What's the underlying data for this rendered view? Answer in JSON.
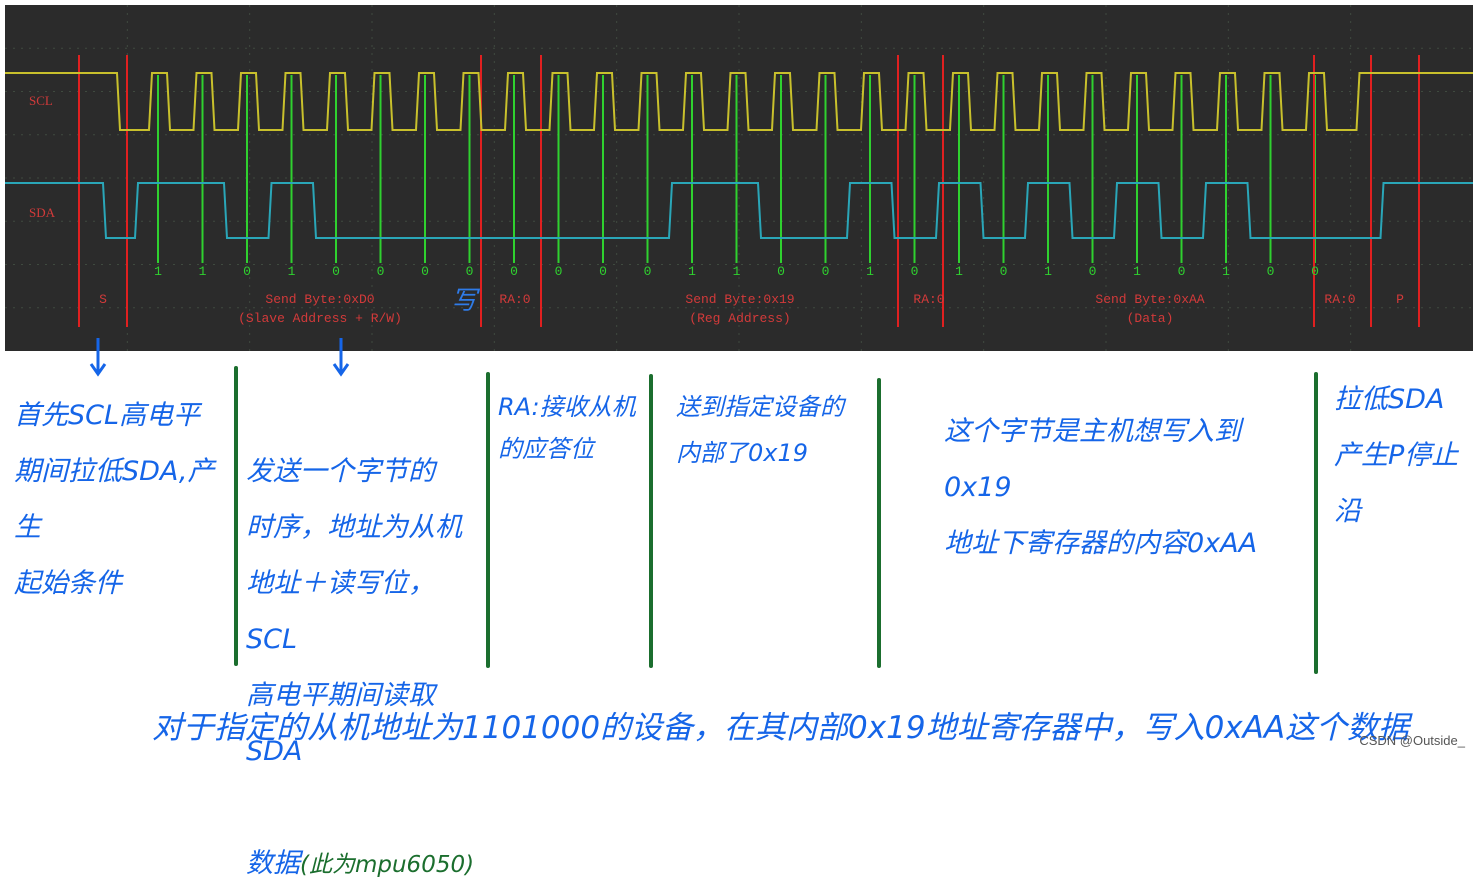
{
  "scope": {
    "channel_scl": "SCL",
    "channel_sda": "SDA",
    "bits": [
      "1",
      "1",
      "0",
      "1",
      "0",
      "0",
      "0",
      "0",
      "0",
      "0",
      "0",
      "0",
      "1",
      "1",
      "0",
      "0",
      "1",
      "0",
      "1",
      "0",
      "1",
      "0",
      "1",
      "0",
      "1",
      "0",
      "0"
    ],
    "segments": [
      {
        "line1": "S",
        "line2": ""
      },
      {
        "line1": "Send Byte:0xD0",
        "line2": "(Slave Address + R/W)"
      },
      {
        "line1": "RA:0",
        "line2": ""
      },
      {
        "line1": "Send Byte:0x19",
        "line2": "(Reg Address)"
      },
      {
        "line1": "RA:0",
        "line2": ""
      },
      {
        "line1": "Send Byte:0xAA",
        "line2": "(Data)"
      },
      {
        "line1": "RA:0",
        "line2": ""
      },
      {
        "line1": "P",
        "line2": ""
      }
    ],
    "write_mark": "写",
    "colors": {
      "background": "#2b2b2b",
      "scl": "#c8c02c",
      "sda": "#2aa6b8",
      "marker_green": "#2fd12f",
      "marker_red": "#e02020",
      "label": "#d23a3a"
    }
  },
  "notes": {
    "start": "首先SCL高电平\n期间拉低SDA,产生\n起始条件",
    "byte_timing": "发送一个字节的\n时序，地址为从机\n地址＋读写位，SCL\n高电平期间读取SDA",
    "byte_timing_tail": "数据",
    "byte_timing_paren": "(此为mpu6050)",
    "ra": "RA:接收从机\n的应答位",
    "reg": "送到指定设备的\n内部了0x19",
    "data": "这个字节是主机想写入到0x19\n地址下寄存器的内容0xAA",
    "stop": "拉低SDA\n产生P停止沿"
  },
  "footer": "对于指定的从机地址为1101000的设备，在其内部0x19地址寄存器中，写入0xAA这个数据",
  "watermark": "CSDN @Outside_"
}
